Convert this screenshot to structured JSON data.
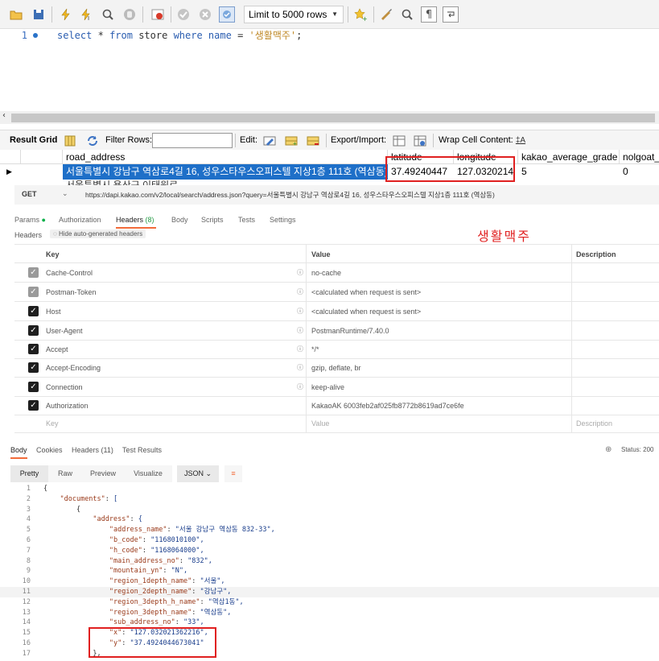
{
  "toolbar": {
    "limit_label": "Limit to 5000 rows"
  },
  "editor": {
    "line_number": "1",
    "sql": {
      "kw_select": "select",
      "star": "*",
      "kw_from": "from",
      "table": "store",
      "kw_where": "where",
      "column": "name",
      "op": "=",
      "value": "'생활맥주'",
      "end": ";"
    }
  },
  "result_bar": {
    "title": "Result Grid",
    "filter_label": "Filter Rows:",
    "edit_label": "Edit:",
    "export_label": "Export/Import:",
    "wrap_label": "Wrap Cell Content:"
  },
  "grid": {
    "columns": [
      "road_address",
      "latitude",
      "longitude",
      "kakao_average_grade",
      "nolgoat_"
    ],
    "row": [
      "서울특별시 강남구 역삼로4길 16, 성우스타우스오피스텔 지상1층 111호 (역삼동)",
      "37.49240447",
      "127.0320214",
      "5",
      "0"
    ],
    "partial_row": "서울특별시 용산구 이태원로 ..."
  },
  "postman": {
    "method": "GET",
    "url": "https://dapi.kakao.com/v2/local/search/address.json?query=서울특별시 강남구 역삼로4길 16, 성우스타우스오피스텔 지상1층 111호 (역삼동)",
    "tabs": {
      "params": "Params",
      "authorization": "Authorization",
      "headers": "Headers",
      "headers_count": "(8)",
      "body": "Body",
      "scripts": "Scripts",
      "tests": "Tests",
      "settings": "Settings"
    },
    "headers_label": "Headers",
    "hide_auto": "Hide auto-generated headers",
    "annotation": "생활맥주",
    "table_headers": {
      "key": "Key",
      "value": "Value",
      "description": "Description"
    },
    "rows": [
      {
        "key": "Cache-Control",
        "value": "no-cache",
        "checked": "grey"
      },
      {
        "key": "Postman-Token",
        "value": "<calculated when request is sent>",
        "checked": "grey"
      },
      {
        "key": "Host",
        "value": "<calculated when request is sent>",
        "checked": "dark"
      },
      {
        "key": "User-Agent",
        "value": "PostmanRuntime/7.40.0",
        "checked": "dark"
      },
      {
        "key": "Accept",
        "value": "*/*",
        "checked": "dark"
      },
      {
        "key": "Accept-Encoding",
        "value": "gzip, deflate, br",
        "checked": "dark"
      },
      {
        "key": "Connection",
        "value": "keep-alive",
        "checked": "dark"
      },
      {
        "key": "Authorization",
        "value": "KakaoAK 6003feb2af025fb8772b8619ad7ce6fe",
        "checked": "dark"
      }
    ],
    "placeholder_row": {
      "key": "Key",
      "value": "Value",
      "description": "Description"
    }
  },
  "response": {
    "tabs": {
      "body": "Body",
      "cookies": "Cookies",
      "headers": "Headers (11)",
      "test_results": "Test Results"
    },
    "status": "Status: 200",
    "formats": {
      "pretty": "Pretty",
      "raw": "Raw",
      "preview": "Preview",
      "visualize": "Visualize",
      "json": "JSON"
    },
    "lines": [
      {
        "n": "1",
        "text": "{"
      },
      {
        "n": "2",
        "text": "    \"documents\": ["
      },
      {
        "n": "3",
        "text": "        {"
      },
      {
        "n": "4",
        "text": "            \"address\": {"
      },
      {
        "n": "5",
        "text": "                \"address_name\": \"서울 강남구 역삼동 832-33\","
      },
      {
        "n": "6",
        "text": "                \"b_code\": \"1168010100\","
      },
      {
        "n": "7",
        "text": "                \"h_code\": \"1168064000\","
      },
      {
        "n": "8",
        "text": "                \"main_address_no\": \"832\","
      },
      {
        "n": "9",
        "text": "                \"mountain_yn\": \"N\","
      },
      {
        "n": "10",
        "text": "                \"region_1depth_name\": \"서울\","
      },
      {
        "n": "11",
        "text": "                \"region_2depth_name\": \"강남구\","
      },
      {
        "n": "12",
        "text": "                \"region_3depth_h_name\": \"역삼1동\","
      },
      {
        "n": "13",
        "text": "                \"region_3depth_name\": \"역삼동\","
      },
      {
        "n": "14",
        "text": "                \"sub_address_no\": \"33\","
      },
      {
        "n": "15",
        "text": "                \"x\": \"127.032021362216\","
      },
      {
        "n": "16",
        "text": "                \"y\": \"37.4924044673041\""
      },
      {
        "n": "17",
        "text": "            },"
      }
    ]
  },
  "colors": {
    "selection": "#1e6fc8",
    "annotation_red": "#e02020"
  }
}
